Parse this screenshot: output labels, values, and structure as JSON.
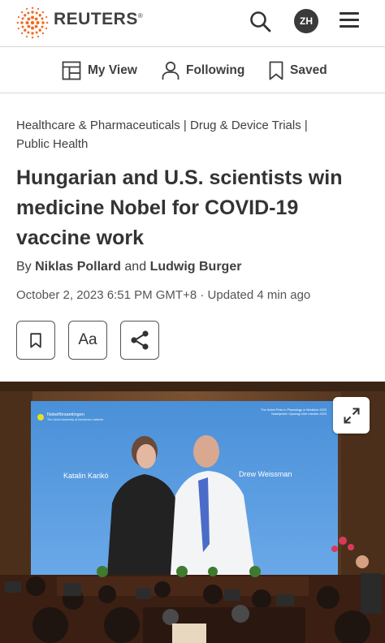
{
  "header": {
    "logo_text": "REUTERS",
    "logo_trademark": "®",
    "avatar_initials": "ZH",
    "brand_color": "#f26a21"
  },
  "nav": {
    "items": [
      {
        "label": "My View",
        "icon": "layout-icon"
      },
      {
        "label": "Following",
        "icon": "person-icon"
      },
      {
        "label": "Saved",
        "icon": "bookmark-icon"
      }
    ]
  },
  "article": {
    "categories": [
      "Healthcare & Pharmaceuticals",
      "Drug & Device Trials",
      "Public Health"
    ],
    "headline": "Hungarian and U.S. scientists win medicine Nobel for COVID-19 vaccine work",
    "byline_prefix": "By",
    "author_1": "Niklas Pollard",
    "byline_joiner": "and",
    "author_2": "Ludwig Burger",
    "dateline": "October 2, 2023 6:51 PM GMT+8 · Updated 4 min ago",
    "font_button_label": "Aa"
  },
  "photo": {
    "screen_org": "Nobelförsamlingen",
    "screen_org_sub": "The Nobel Assembly at Karolinska Institutet",
    "screen_prize_en": "The Nobel Prize in Physiology or Medicine 2023",
    "screen_prize_sv": "Nobelpriset i fysiologi eller medicin 2023",
    "laureate_1": "Katalin Karikó",
    "laureate_2": "Drew Weissman"
  }
}
